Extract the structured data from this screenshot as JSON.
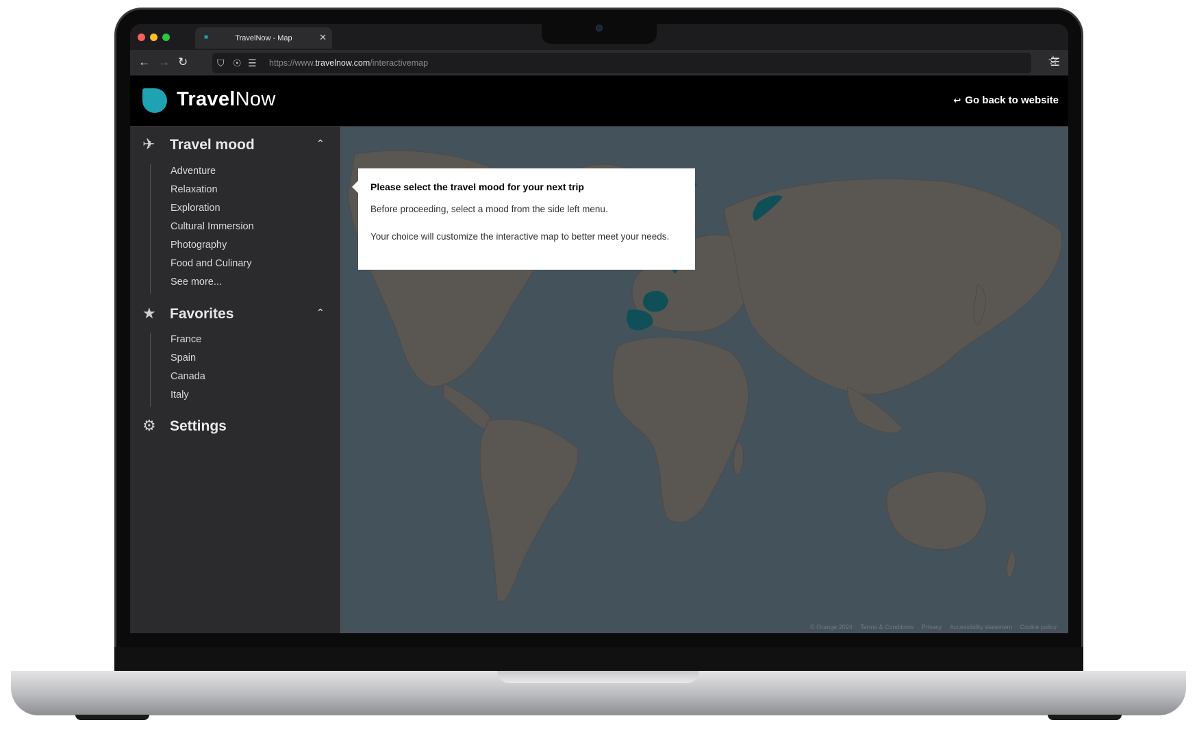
{
  "browser": {
    "tab_title": "TravelNow - Map",
    "url_prefix": "https://www.",
    "url_domain": "travelnow.com",
    "url_path": "/interactivemap",
    "colors": {
      "close": "#ff5f57",
      "minimize": "#febc2e",
      "maximize": "#28c840"
    }
  },
  "header": {
    "logo_bold": "Travel",
    "logo_light": "Now",
    "back_label": "Go back to website",
    "brand_color": "#1fa3b3"
  },
  "sidebar": {
    "travel_mood": {
      "title": "Travel mood",
      "icon": "airplane-icon",
      "items": [
        "Adventure",
        "Relaxation",
        "Exploration",
        "Cultural Immersion",
        "Photography",
        "Food and Culinary",
        "See more..."
      ]
    },
    "favorites": {
      "title": "Favorites",
      "icon": "star-icon",
      "items": [
        "France",
        "Spain",
        "Canada",
        "Italy"
      ]
    },
    "settings": {
      "title": "Settings",
      "icon": "gear-icon"
    }
  },
  "tooltip": {
    "title": "Please select the travel mood for your next trip",
    "line1": "Before proceeding, select a mood from the side left menu.",
    "line2": "Your choice will customize the interactive map to better meet your needs."
  },
  "map": {
    "ocean_color": "#44525c",
    "land_color": "#5a5753",
    "highlight_color": "#0f4f57",
    "footer_links": [
      "© Orange 2024",
      "Terms & Conditions",
      "Privacy",
      "Accessibility statement",
      "Cookie policy"
    ]
  }
}
